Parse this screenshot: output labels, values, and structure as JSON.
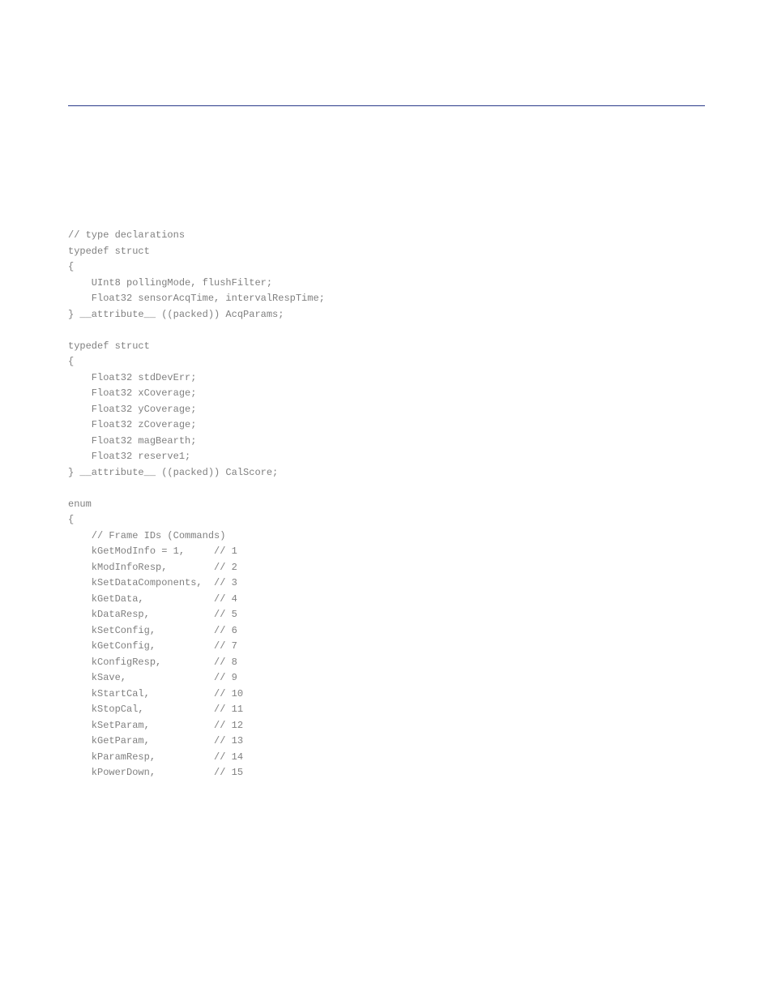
{
  "code": "// type declarations\ntypedef struct\n{\n    UInt8 pollingMode, flushFilter;\n    Float32 sensorAcqTime, intervalRespTime;\n} __attribute__ ((packed)) AcqParams;\n\ntypedef struct\n{\n    Float32 stdDevErr;\n    Float32 xCoverage;\n    Float32 yCoverage;\n    Float32 zCoverage;\n    Float32 magBearth;\n    Float32 reserve1;\n} __attribute__ ((packed)) CalScore;\n\nenum\n{\n    // Frame IDs (Commands)\n    kGetModInfo = 1,     // 1\n    kModInfoResp,        // 2\n    kSetDataComponents,  // 3\n    kGetData,            // 4\n    kDataResp,           // 5\n    kSetConfig,          // 6\n    kGetConfig,          // 7\n    kConfigResp,         // 8\n    kSave,               // 9\n    kStartCal,           // 10\n    kStopCal,            // 11\n    kSetParam,           // 12\n    kGetParam,           // 13\n    kParamResp,          // 14\n    kPowerDown,          // 15"
}
